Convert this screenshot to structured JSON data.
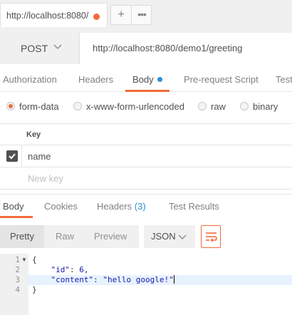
{
  "tab": {
    "title": "http://localhost:8080/",
    "plus": "+",
    "more": "•••"
  },
  "request": {
    "method": "POST",
    "url": "http://localhost:8080/demo1/greeting"
  },
  "request_tabs": [
    "Authorization",
    "Headers",
    "Body",
    "Pre-request Script",
    "Tests"
  ],
  "body_types": [
    "form-data",
    "x-www-form-urlencoded",
    "raw",
    "binary"
  ],
  "selected_body_type": "form-data",
  "params_table": {
    "key_header": "Key",
    "rows": [
      {
        "key": "name",
        "checked": true
      }
    ],
    "new_key_placeholder": "New key"
  },
  "response_tabs": {
    "body": "Body",
    "cookies": "Cookies",
    "headers": "Headers",
    "headers_count": "(3)",
    "tests": "Test Results"
  },
  "view_modes": [
    "Pretty",
    "Raw",
    "Preview"
  ],
  "format": "JSON",
  "response_body": {
    "line_numbers": [
      "1",
      "2",
      "3",
      "4"
    ],
    "open_brace": "{",
    "id_key": "\"id\"",
    "id_value": "6",
    "content_key": "\"content\"",
    "content_value": "\"hello google!\"",
    "close_brace": "}"
  },
  "colors": {
    "accent": "#f26b3a",
    "blue": "#2a8fd6"
  }
}
